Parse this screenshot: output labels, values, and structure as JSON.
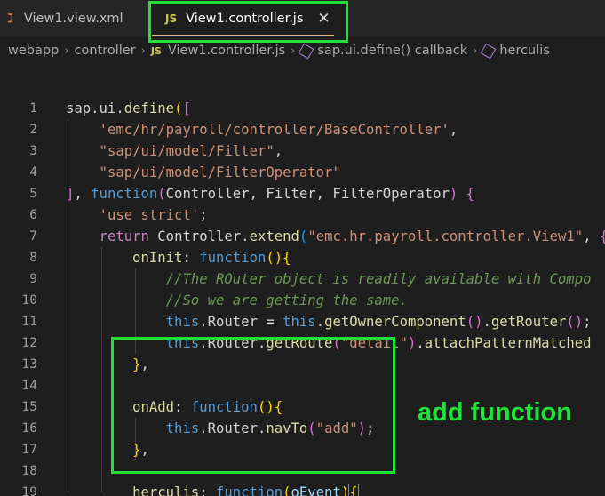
{
  "tabs": [
    {
      "icon": "xml-icon",
      "icon_text": "ℷ",
      "label": "View1.view.xml"
    },
    {
      "icon": "js-icon",
      "icon_text": "JS",
      "label": "View1.controller.js",
      "close": "✕",
      "active": true
    }
  ],
  "breadcrumb": {
    "items": [
      "webapp",
      "controller",
      "View1.controller.js",
      "sap.ui.define() callback",
      "herculis"
    ],
    "file_icon_text": "JS",
    "separator": "›"
  },
  "editor": {
    "line_numbers": [
      "1",
      "2",
      "3",
      "4",
      "5",
      "6",
      "7",
      "8",
      "9",
      "10",
      "11",
      "12",
      "13",
      "14",
      "15",
      "16",
      "17",
      "18",
      "19"
    ]
  },
  "annotation": {
    "label": "add function",
    "color": "#22e03a"
  },
  "colors": {
    "keyword": "#569cd6",
    "control": "#c586c0",
    "string": "#ce9178",
    "function": "#dcdcaa",
    "comment": "#6a9955",
    "highlight": "#22e03a"
  }
}
